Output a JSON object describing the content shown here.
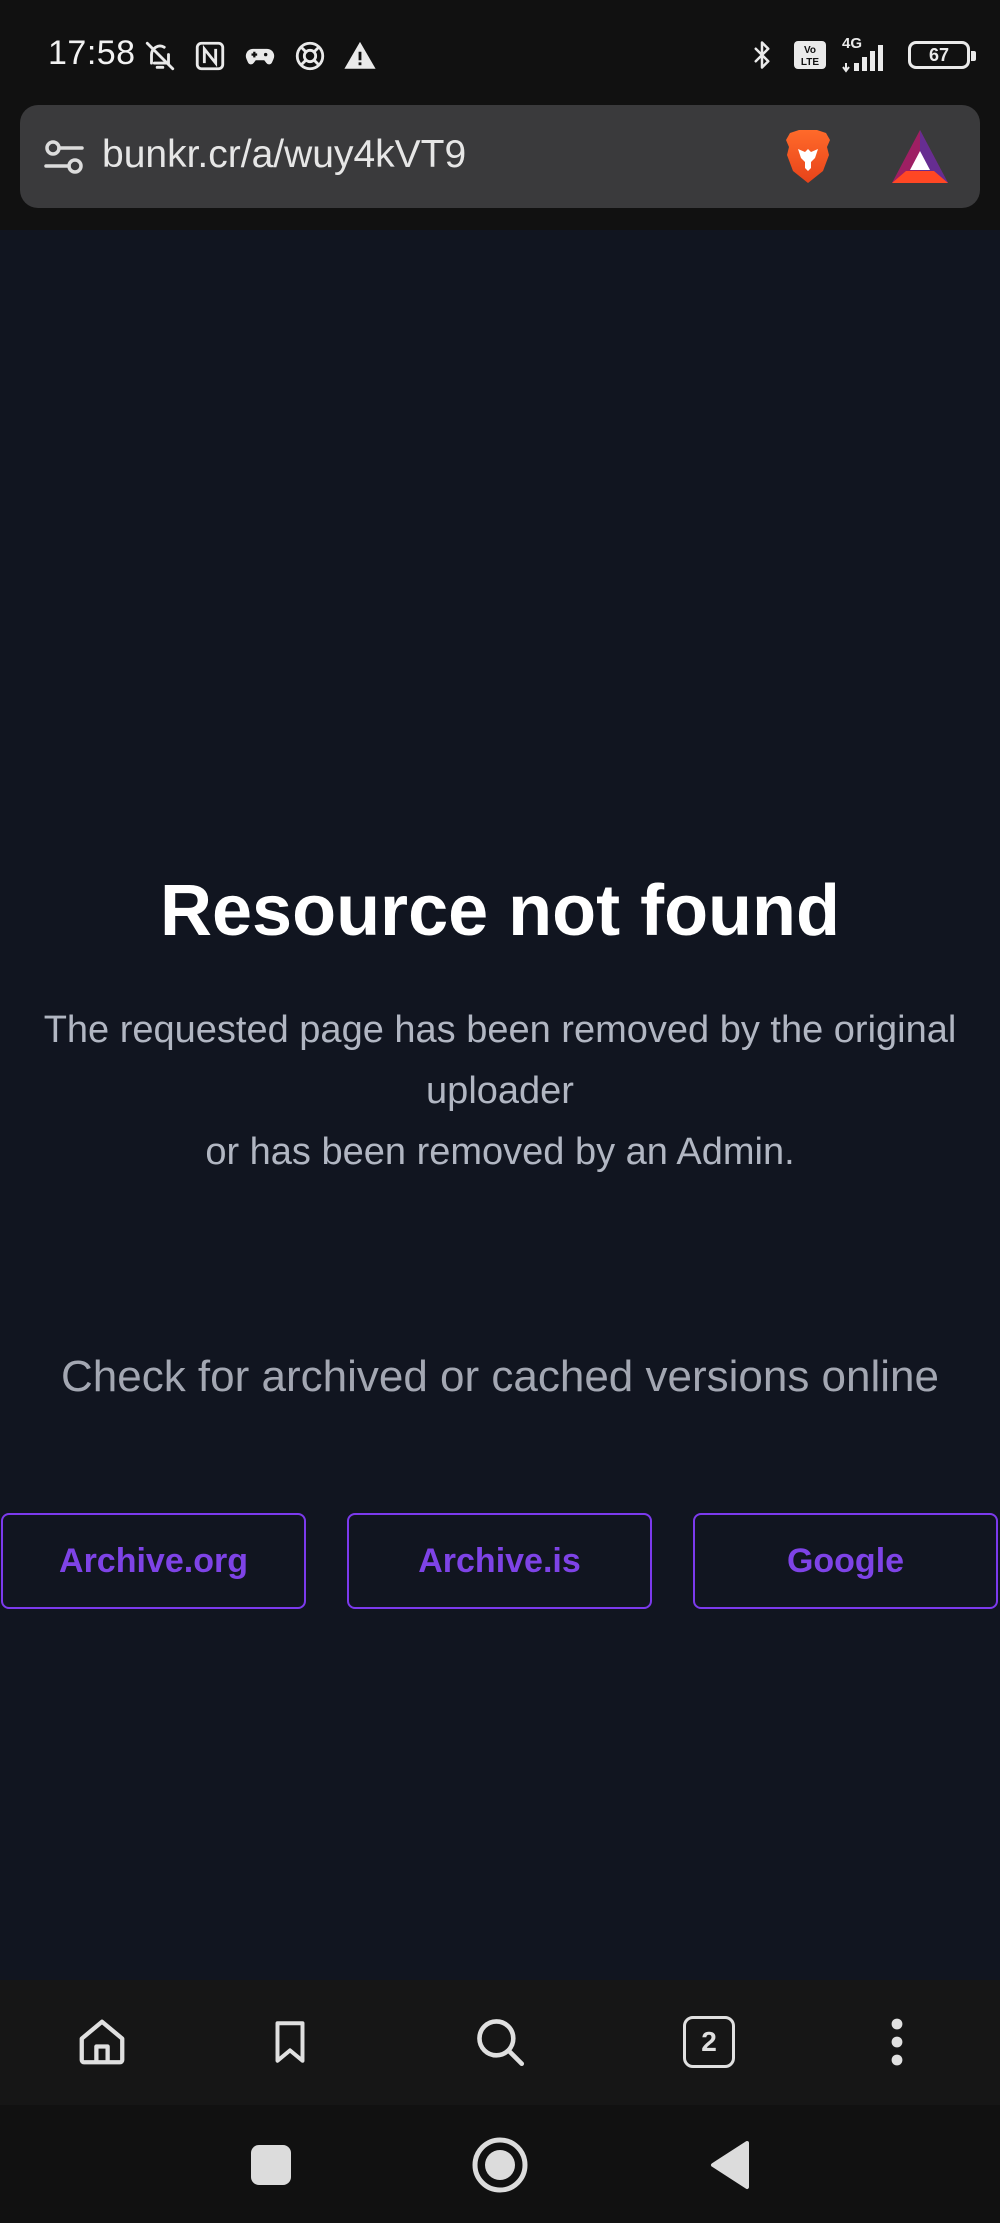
{
  "status_bar": {
    "time": "17:58",
    "battery": "67",
    "network": "4G",
    "left_icons": [
      "bell-off-icon",
      "nfc-icon",
      "game-controller-icon",
      "lifebuoy-icon",
      "warning-icon"
    ],
    "right_icons": [
      "bluetooth-icon",
      "volte-icon",
      "signal-icon",
      "battery-icon"
    ]
  },
  "url_bar": {
    "url": "bunkr.cr/a/wuy4kVT9"
  },
  "page": {
    "title": "Resource not found",
    "message_line1": "The requested page has been removed by the original uploader",
    "message_line2": "or has been removed by an Admin.",
    "archive_hint": "Check for archived or cached versions online",
    "buttons": [
      {
        "label": "Archive.org"
      },
      {
        "label": "Archive.is"
      },
      {
        "label": "Google"
      }
    ]
  },
  "toolbar": {
    "tab_count": "2"
  },
  "colors": {
    "page_bg": "#111520",
    "accent": "#7c3aed",
    "urlbar_bg": "#3a3a3c"
  }
}
